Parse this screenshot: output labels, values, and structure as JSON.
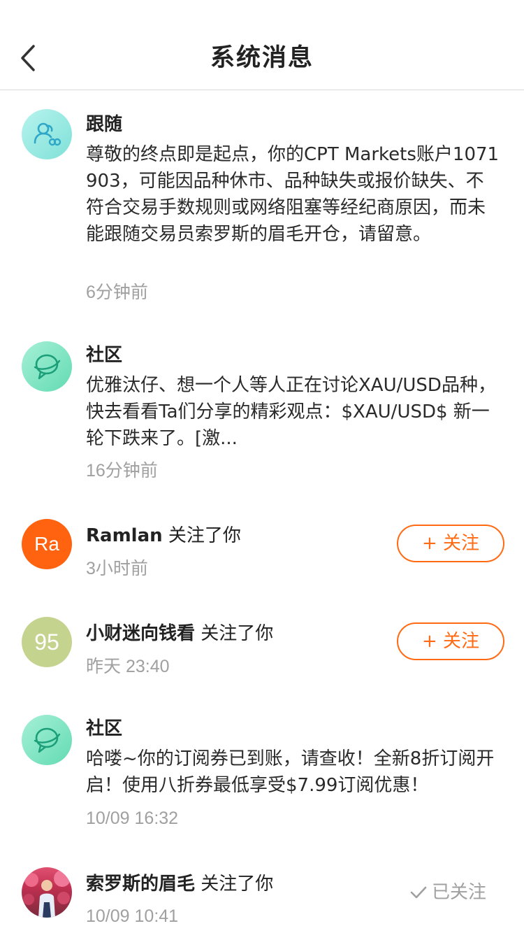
{
  "header": {
    "title": "系统消息"
  },
  "messages": [
    {
      "type": "follow-notice",
      "title": "跟随",
      "text": " 尊敬的终点即是起点，你的CPT Markets账户1071903，可能因品种休市、品种缺失或报价缺失、不符合交易手数规则或网络阻塞等经纪商原因，而未能跟随交易员索罗斯的眉毛开仓，请留意。",
      "time": "6分钟前"
    },
    {
      "type": "community",
      "title": "社区",
      "text": "优雅汰仔、想一个人等人正在讨论XAU/USD品种，快去看看Ta们分享的精彩观点：$XAU/USD$ 新一轮下跌来了。[激...",
      "time": "16分钟前"
    },
    {
      "type": "user-follow",
      "avatar_text": "Ra",
      "name": "Ramlan",
      "action": " 关注了你",
      "time": "3小时前",
      "button": "+ 关注"
    },
    {
      "type": "user-follow",
      "avatar_text": "95",
      "name": "小财迷向钱看",
      "action": " 关注了你",
      "time": "昨天 23:40",
      "button": "+ 关注"
    },
    {
      "type": "community",
      "title": "社区",
      "text": "哈喽~你的订阅券已到账，请查收！全新8折订阅开启！使用八折券最低享受$7.99订阅优惠！",
      "time": "10/09 16:32"
    },
    {
      "type": "user-follow",
      "name": "索罗斯的眉毛",
      "action": " 关注了你",
      "time": "10/09 10:41",
      "button": "已关注"
    }
  ],
  "colors": {
    "accent": "#ff6a13",
    "avatar_orange": "#ff6310",
    "avatar_olive": "#c4d38e",
    "avatar_teal": "#7fe1d8",
    "avatar_green": "#63dbb2",
    "muted_text": "#a0a0a0"
  },
  "icons": {
    "back": "chevron-left-icon",
    "follow_notice": "users-link-icon",
    "community": "planet-chat-icon",
    "followed": "check-icon"
  }
}
